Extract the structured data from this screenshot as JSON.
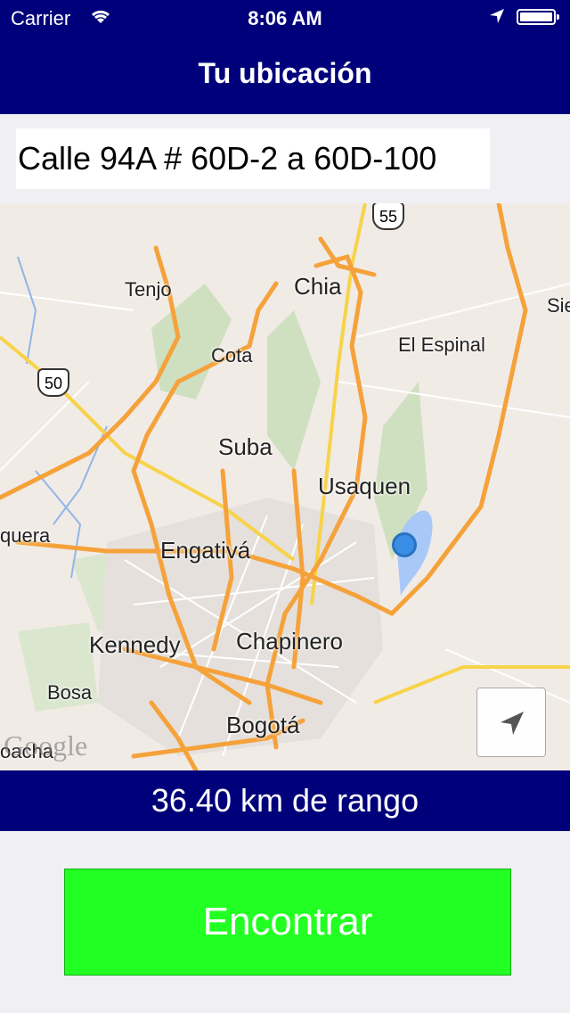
{
  "status_bar": {
    "carrier": "Carrier",
    "time": "8:06 AM",
    "battery_level": 1.0
  },
  "header": {
    "title": "Tu ubicación"
  },
  "address": {
    "value": "Calle 94A # 60D-2 a 60D-100",
    "add_icon": "plus-circle-icon"
  },
  "map": {
    "labels": {
      "tenjo": "Tenjo",
      "chia": "Chia",
      "cota": "Cota",
      "el_espinal": "El Espinal",
      "suba": "Suba",
      "usaquen": "Usaquen",
      "quera": "quera",
      "engativa": "Engativá",
      "kennedy": "Kennedy",
      "chapinero": "Chapinero",
      "bosa": "Bosa",
      "bogota": "Bogotá",
      "soacha": "oacha",
      "sie": "Sie"
    },
    "shields": {
      "r55": "55",
      "r50": "50"
    },
    "watermark": "Google",
    "location_button_icon": "navigation-arrow-icon"
  },
  "range": {
    "label": "36.40 km de rango"
  },
  "actions": {
    "find_label": "Encontrar"
  },
  "colors": {
    "nav_bar": "#00007a",
    "find_button": "#22ff22",
    "user_dot": "#3a8ee6"
  }
}
